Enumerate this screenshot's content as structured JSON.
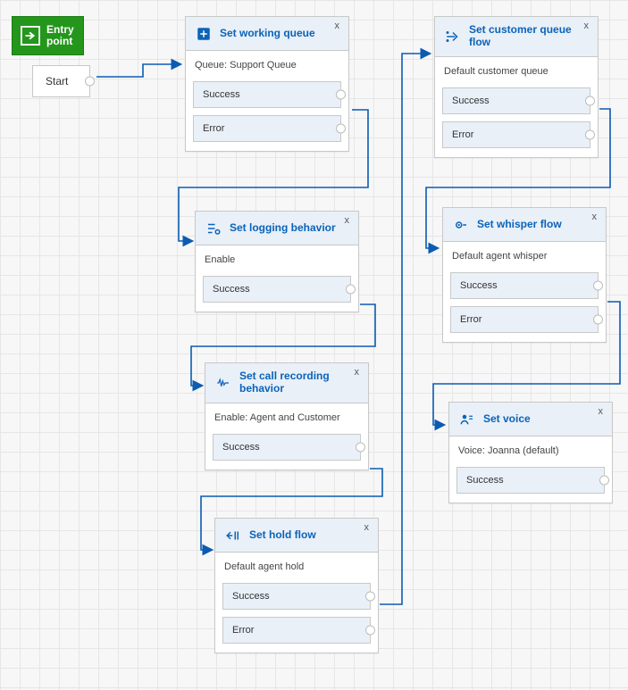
{
  "entry": {
    "label": "Entry\npoint"
  },
  "start": {
    "label": "Start"
  },
  "close_label": "x",
  "nodes": {
    "wq": {
      "title": "Set working queue",
      "body": "Queue: Support Queue",
      "outcomes": [
        "Success",
        "Error"
      ]
    },
    "cq": {
      "title": "Set customer queue flow",
      "body": "Default customer queue",
      "outcomes": [
        "Success",
        "Error"
      ]
    },
    "lb": {
      "title": "Set logging behavior",
      "body": "Enable",
      "outcomes": [
        "Success"
      ]
    },
    "wf": {
      "title": "Set whisper flow",
      "body": "Default agent whisper",
      "outcomes": [
        "Success",
        "Error"
      ]
    },
    "cr": {
      "title": "Set call recording behavior",
      "body": "Enable: Agent and Customer",
      "outcomes": [
        "Success"
      ]
    },
    "sv": {
      "title": "Set voice",
      "body": "Voice: Joanna (default)",
      "outcomes": [
        "Success"
      ]
    },
    "hf": {
      "title": "Set hold flow",
      "body": "Default agent hold",
      "outcomes": [
        "Success",
        "Error"
      ]
    }
  }
}
